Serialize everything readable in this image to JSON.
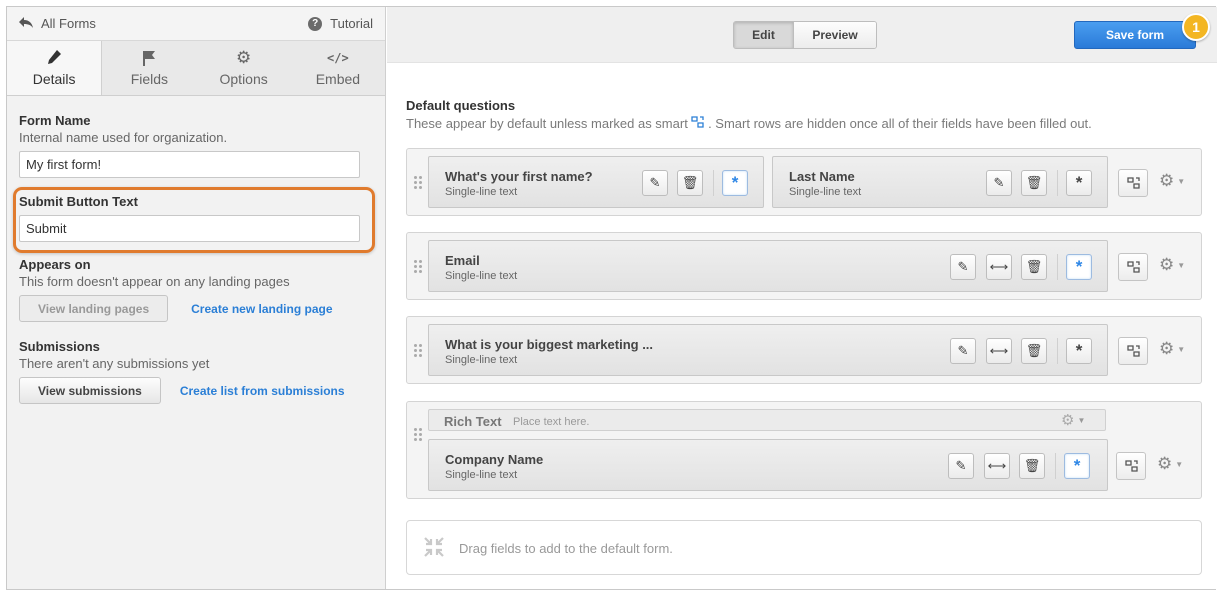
{
  "nav": {
    "back_label": "All Forms",
    "tutorial_label": "Tutorial"
  },
  "tabs": [
    {
      "label": "Details",
      "icon": "pencil-icon",
      "active": true
    },
    {
      "label": "Fields",
      "icon": "flag-icon",
      "active": false
    },
    {
      "label": "Options",
      "icon": "gear-icon",
      "active": false
    },
    {
      "label": "Embed",
      "icon": "code-icon",
      "active": false
    }
  ],
  "details": {
    "form_name": {
      "title": "Form Name",
      "subtitle": "Internal name used for organization.",
      "value": "My first form!"
    },
    "submit_text": {
      "title": "Submit Button Text",
      "value": "Submit"
    },
    "appears_on": {
      "title": "Appears on",
      "subtitle": "This form doesn't appear on any landing pages",
      "view_button": "View landing pages",
      "create_link": "Create new landing page"
    },
    "submissions": {
      "title": "Submissions",
      "subtitle": "There aren't any submissions yet",
      "view_button": "View submissions",
      "create_link": "Create list from submissions"
    }
  },
  "toolbar": {
    "edit_label": "Edit",
    "preview_label": "Preview",
    "save_label": "Save form",
    "badge": "1"
  },
  "default_questions": {
    "title": "Default questions",
    "subtitle_before": "These appear by default unless marked as smart",
    "subtitle_after": ". Smart rows are hidden once all of their fields have been filled out."
  },
  "rows": [
    {
      "fields": [
        {
          "label": "What's your first name?",
          "type": "Single-line text",
          "required": true
        },
        {
          "label": "Last Name",
          "type": "Single-line text",
          "required": false
        }
      ]
    },
    {
      "fields": [
        {
          "label": "Email",
          "type": "Single-line text",
          "required": true
        }
      ]
    },
    {
      "fields": [
        {
          "label": "What is your biggest marketing ...",
          "type": "Single-line text",
          "required": false
        }
      ]
    },
    {
      "rich_text": {
        "label": "Rich Text",
        "placeholder": "Place text here."
      },
      "fields": [
        {
          "label": "Company Name",
          "type": "Single-line text",
          "required": true
        }
      ]
    }
  ],
  "drop_zone": "Drag fields to add to the default form.",
  "colors": {
    "accent_blue": "#2b7fd6",
    "save_button": "#2a7ad8",
    "highlight_orange": "#e07b2e",
    "badge_yellow": "#f3b623"
  }
}
